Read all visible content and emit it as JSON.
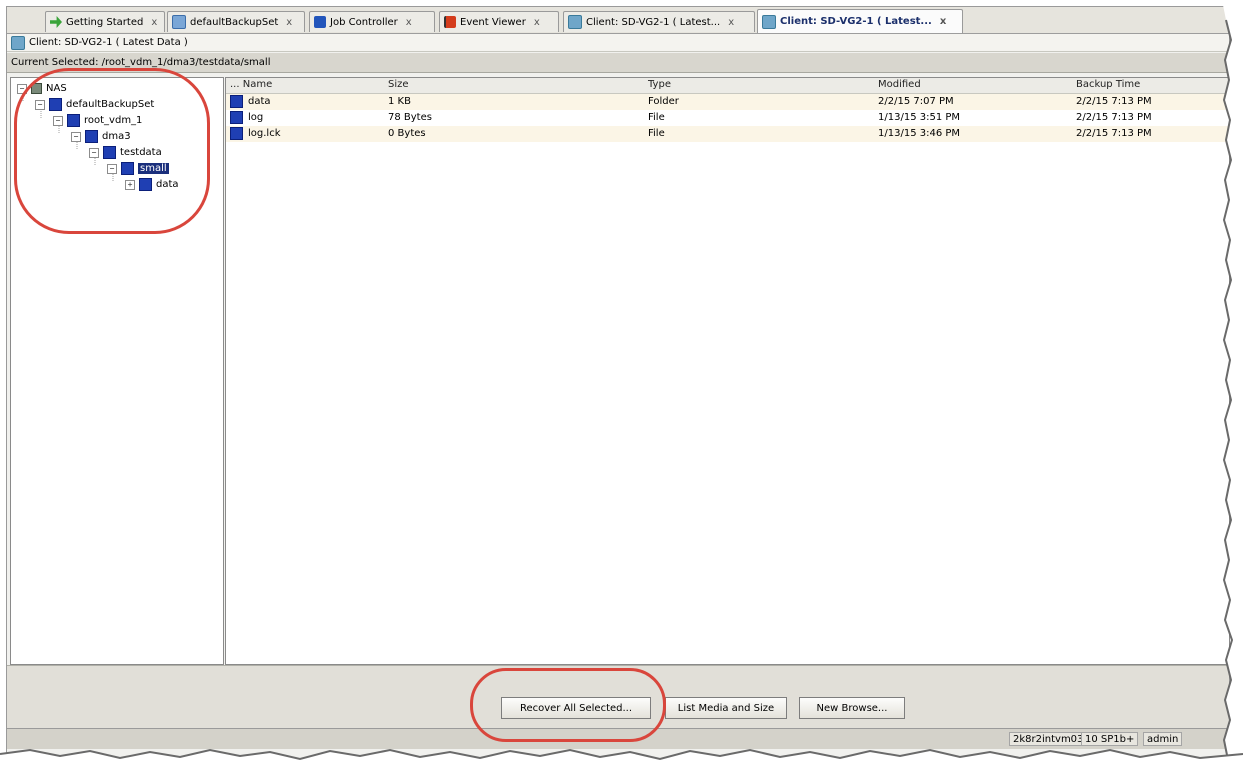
{
  "tabs": [
    {
      "label": "Getting Started",
      "icon": "arrow-right-icon",
      "close": "x"
    },
    {
      "label": "defaultBackupSet",
      "icon": "folder-icon",
      "close": "x"
    },
    {
      "label": "Job Controller",
      "icon": "job-controller-icon",
      "close": "x"
    },
    {
      "label": "Event Viewer",
      "icon": "flag-icon",
      "close": "x"
    },
    {
      "label": "Client: SD-VG2-1 ( Latest...",
      "icon": "client-icon",
      "close": "x"
    },
    {
      "label": "Client: SD-VG2-1 ( Latest...",
      "icon": "client-icon",
      "close": "x",
      "active": true
    }
  ],
  "header": {
    "title": "Client: SD-VG2-1 ( Latest Data )"
  },
  "path_bar": {
    "text": "Current Selected: /root_vdm_1/dma3/testdata/small"
  },
  "tree": {
    "nodes": [
      {
        "label": "NAS",
        "expander": "−"
      },
      {
        "label": "defaultBackupSet",
        "expander": "−"
      },
      {
        "label": "root_vdm_1",
        "expander": "−"
      },
      {
        "label": "dma3",
        "expander": "−"
      },
      {
        "label": "testdata",
        "expander": "−"
      },
      {
        "label": "small",
        "expander": "−",
        "selected": true
      },
      {
        "label": "data",
        "expander": "+"
      }
    ]
  },
  "list": {
    "columns": [
      "... Name",
      "Size",
      "Type",
      "Modified",
      "Backup Time"
    ],
    "rows": [
      {
        "name": "data",
        "size": "1 KB",
        "type": "Folder",
        "modified": "2/2/15 7:07 PM",
        "backup_time": "2/2/15 7:13 PM"
      },
      {
        "name": "log",
        "size": "78 Bytes",
        "type": "File",
        "modified": "1/13/15 3:51 PM",
        "backup_time": "2/2/15 7:13 PM"
      },
      {
        "name": "log.lck",
        "size": "0 Bytes",
        "type": "File",
        "modified": "1/13/15 3:46 PM",
        "backup_time": "2/2/15 7:13 PM"
      }
    ]
  },
  "buttons": {
    "recover": "Recover All Selected...",
    "list_media": "List Media and Size",
    "new_browse": "New Browse..."
  },
  "status_bar": {
    "server": "2k8r2intvm03",
    "version": "10 SP1b+",
    "user": "admin"
  },
  "colors": {
    "annotation": "#d9463c",
    "selected_node": "#1a2f7c",
    "node_icon": "#1f3fb3"
  }
}
